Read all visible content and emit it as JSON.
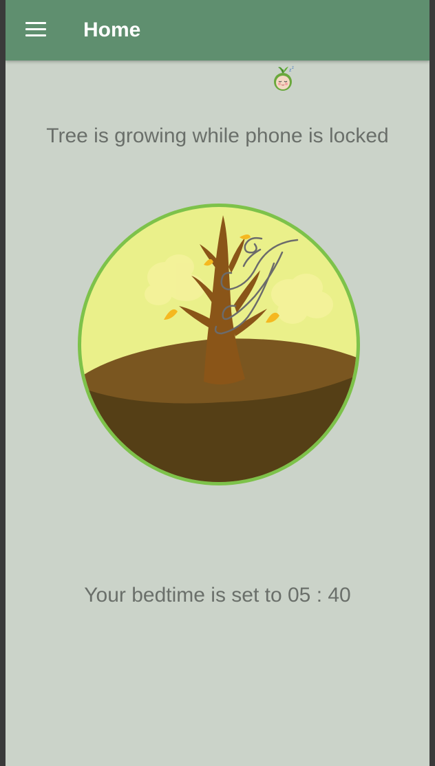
{
  "appbar": {
    "title": "Home",
    "menu_icon": "hamburger-menu-icon",
    "color": "#5f8f6f"
  },
  "mascot": {
    "icon": "sleeping-sprout-mascot-icon"
  },
  "main": {
    "status_text": "Tree is growing while phone is locked",
    "scene_icon": "growing-tree-scene-illustration",
    "bedtime_text": "Your bedtime is set to 05 : 40"
  },
  "colors": {
    "background": "#cbd3c9",
    "text": "#6a6f6a",
    "ring": "#7dc24a"
  }
}
